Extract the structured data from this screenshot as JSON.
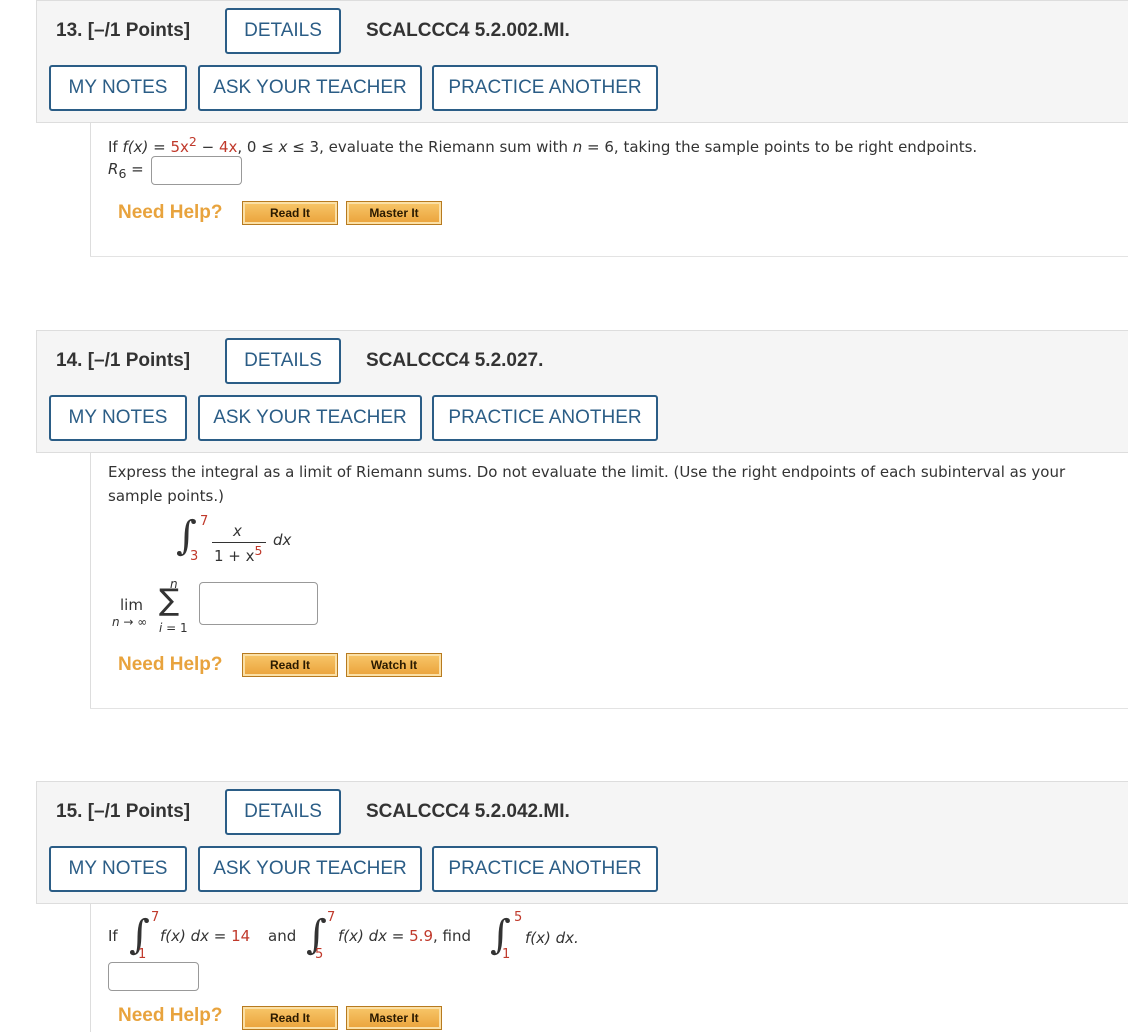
{
  "buttons": {
    "details": "DETAILS",
    "my_notes": "MY NOTES",
    "ask_teacher": "ASK YOUR TEACHER",
    "practice_another": "PRACTICE ANOTHER"
  },
  "help": {
    "label": "Need Help?",
    "read_it": "Read It",
    "master_it": "Master It",
    "watch_it": "Watch It"
  },
  "q13": {
    "title": "13. [–/1 Points]",
    "code": "SCALCCC4 5.2.002.MI.",
    "p_if": "If ",
    "p_fx": "f(x)",
    "p_eq": " = ",
    "p_5x": "5x",
    "p_sq": "2",
    "p_minus": " − ",
    "p_4x": "4x",
    "p_range": ", 0 ≤ ",
    "p_x": "x",
    "p_le3": " ≤ 3,  evaluate the Riemann sum with ",
    "p_n": "n",
    "p_rest": " = 6, taking the sample points to be right endpoints.",
    "r_label": "R",
    "r_sub": "6",
    "r_eq": " ="
  },
  "q14": {
    "title": "14. [–/1 Points]",
    "code": "SCALCCC4 5.2.027.",
    "prompt_line1": "Express the integral as a limit of Riemann sums. Do not evaluate the limit. (Use the right endpoints of each subinterval as your",
    "prompt_line2": "sample points.)",
    "upper": "7",
    "lower": "3",
    "numerator": "x",
    "den_base": "1 + x",
    "den_exp": "5",
    "dx": "dx",
    "lim": "lim",
    "lim_sub": "n → ∞",
    "sum_top": "n",
    "sum_sym": "∑",
    "sum_bottom": "i = 1"
  },
  "q15": {
    "title": "15. [–/1 Points]",
    "code": "SCALCCC4 5.2.042.MI.",
    "if": "If",
    "i1_upper": "7",
    "i1_lower": "1",
    "i1_body": "f(x) dx = ",
    "i1_value": "14",
    "and": "and",
    "i2_upper": "7",
    "i2_lower": "5",
    "i2_body": "f(x) dx = ",
    "i2_value": "5.9",
    "find": ", find",
    "i3_upper": "5",
    "i3_lower": "1",
    "i3_body": "f(x) dx."
  }
}
